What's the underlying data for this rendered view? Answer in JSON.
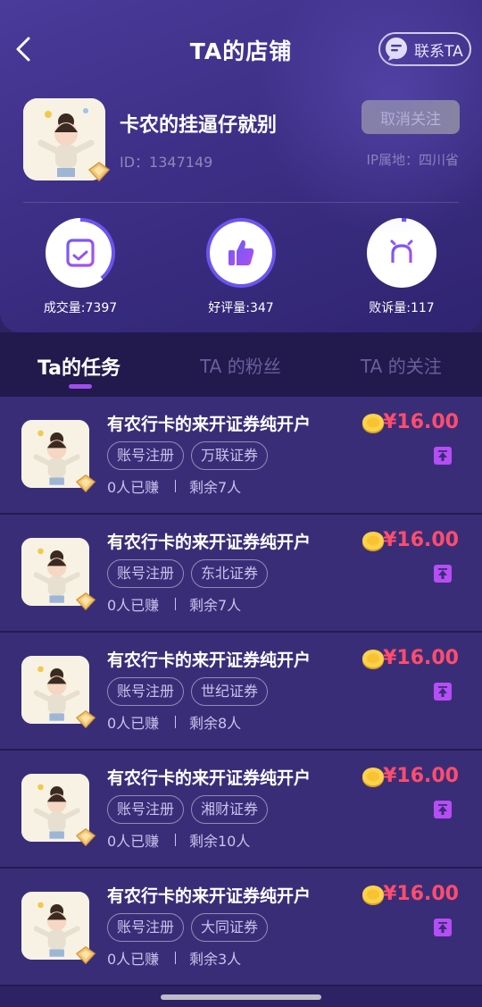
{
  "nav": {
    "title": "TA的店铺",
    "contact_label": "联系TA"
  },
  "shop": {
    "name": "卡农的挂逼仔就别",
    "id_text": "ID：1347149",
    "ip_text": "IP属地：四川省",
    "unfollow_label": "取消关注"
  },
  "stats": [
    {
      "label": "成交量:7397",
      "icon": "clipboard-check-icon"
    },
    {
      "label": "好评量:347",
      "icon": "thumbs-up-icon"
    },
    {
      "label": "败诉量:117",
      "icon": "alarm-light-icon"
    }
  ],
  "tabs": [
    {
      "label": "Ta的任务",
      "active": true
    },
    {
      "label": "TA 的粉丝",
      "active": false
    },
    {
      "label": "TA 的关注",
      "active": false
    }
  ],
  "tasks": [
    {
      "title": "有农行卡的来开证券纯开户",
      "price": "¥16.00",
      "tags": [
        "账号注册",
        "万联证券"
      ],
      "earned": "0人已赚",
      "remaining": "剩余7人"
    },
    {
      "title": "有农行卡的来开证券纯开户",
      "price": "¥16.00",
      "tags": [
        "账号注册",
        "东北证券"
      ],
      "earned": "0人已赚",
      "remaining": "剩余7人"
    },
    {
      "title": "有农行卡的来开证券纯开户",
      "price": "¥16.00",
      "tags": [
        "账号注册",
        "世纪证券"
      ],
      "earned": "0人已赚",
      "remaining": "剩余8人"
    },
    {
      "title": "有农行卡的来开证券纯开户",
      "price": "¥16.00",
      "tags": [
        "账号注册",
        "湘财证券"
      ],
      "earned": "0人已赚",
      "remaining": "剩余10人"
    },
    {
      "title": "有农行卡的来开证券纯开户",
      "price": "¥16.00",
      "tags": [
        "账号注册",
        "大同证券"
      ],
      "earned": "0人已赚",
      "remaining": "剩余3人"
    }
  ],
  "colors": {
    "accent": "#a24cf0",
    "price": "#ff4d6d",
    "background": "#2d2364"
  }
}
